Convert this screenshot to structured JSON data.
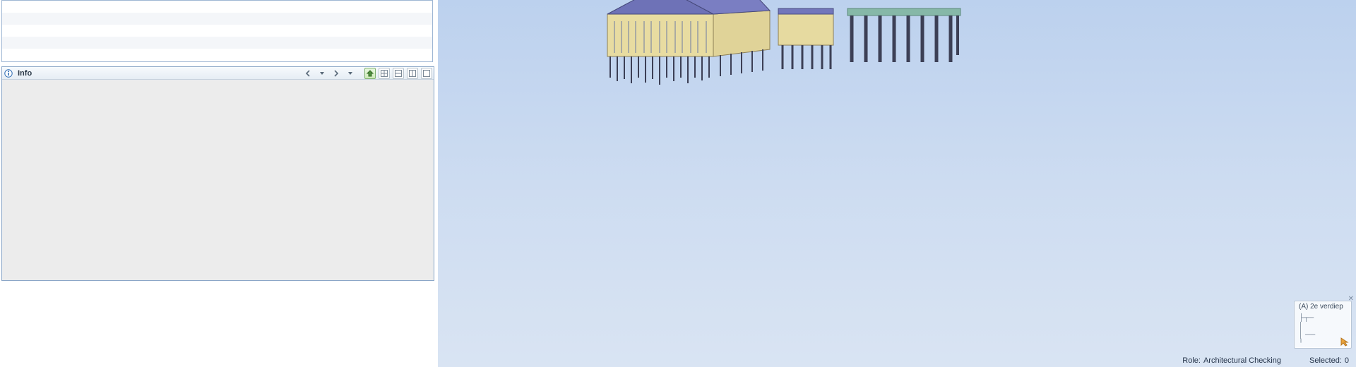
{
  "panels": {
    "info": {
      "title": "Info",
      "nav": {
        "prev_tip": "Previous",
        "prev_menu_tip": "Previous menu",
        "next_tip": "Next",
        "next_menu_tip": "Next menu"
      },
      "tools": {
        "home_tip": "Home",
        "grid1_tip": "Layout 1",
        "grid2_tip": "Layout 2",
        "grid3_tip": "Layout 3",
        "grid4_tip": "Layout 4"
      }
    }
  },
  "viewport": {
    "navigator": {
      "label": "(A) 2e verdiep",
      "close_tip": "Close"
    }
  },
  "status": {
    "role_label": "Role:",
    "role_value": "Architectural Checking",
    "selected_label": "Selected:",
    "selected_value": "0"
  },
  "icons": {
    "info": "info-icon",
    "chev_left": "chevron-left-icon",
    "chev_right": "chevron-right-icon",
    "caret_down": "caret-down-icon",
    "home": "home-arrow-icon",
    "grid": "grid-icon",
    "cursor": "cursor-icon"
  }
}
